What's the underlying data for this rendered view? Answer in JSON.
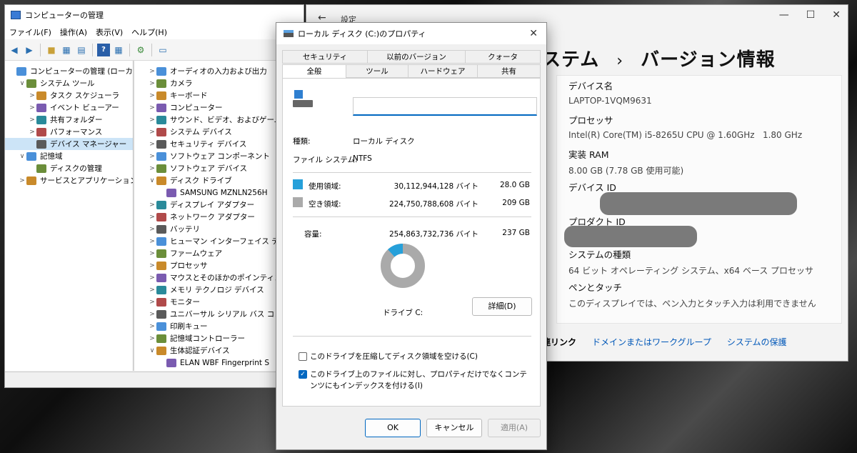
{
  "computer_management": {
    "title": "コンピューターの管理",
    "menu": [
      "ファイル(F)",
      "操作(A)",
      "表示(V)",
      "ヘルプ(H)"
    ],
    "tree": [
      {
        "label": "コンピューターの管理 (ローカル)",
        "arrow": "",
        "indent": 0
      },
      {
        "label": "システム ツール",
        "arrow": "∨",
        "indent": 1
      },
      {
        "label": "タスク スケジューラ",
        "arrow": ">",
        "indent": 2
      },
      {
        "label": "イベント ビューアー",
        "arrow": ">",
        "indent": 2
      },
      {
        "label": "共有フォルダー",
        "arrow": ">",
        "indent": 2
      },
      {
        "label": "パフォーマンス",
        "arrow": ">",
        "indent": 2
      },
      {
        "label": "デバイス マネージャー",
        "arrow": "",
        "indent": 2,
        "selected": true
      },
      {
        "label": "記憶域",
        "arrow": "∨",
        "indent": 1
      },
      {
        "label": "ディスクの管理",
        "arrow": "",
        "indent": 2
      },
      {
        "label": "サービスとアプリケーション",
        "arrow": ">",
        "indent": 1
      }
    ],
    "devices": [
      {
        "label": "オーディオの入力および出力",
        "arrow": ">",
        "indent": 1
      },
      {
        "label": "カメラ",
        "arrow": ">",
        "indent": 1
      },
      {
        "label": "キーボード",
        "arrow": ">",
        "indent": 1
      },
      {
        "label": "コンピューター",
        "arrow": ">",
        "indent": 1
      },
      {
        "label": "サウンド、ビデオ、およびゲーム コン",
        "arrow": ">",
        "indent": 1
      },
      {
        "label": "システム デバイス",
        "arrow": ">",
        "indent": 1
      },
      {
        "label": "セキュリティ デバイス",
        "arrow": ">",
        "indent": 1
      },
      {
        "label": "ソフトウェア コンポーネント",
        "arrow": ">",
        "indent": 1
      },
      {
        "label": "ソフトウェア デバイス",
        "arrow": ">",
        "indent": 1
      },
      {
        "label": "ディスク ドライブ",
        "arrow": "∨",
        "indent": 1
      },
      {
        "label": "SAMSUNG MZNLN256H",
        "arrow": "",
        "indent": 2
      },
      {
        "label": "ディスプレイ アダプター",
        "arrow": ">",
        "indent": 1
      },
      {
        "label": "ネットワーク アダプター",
        "arrow": ">",
        "indent": 1
      },
      {
        "label": "バッテリ",
        "arrow": ">",
        "indent": 1
      },
      {
        "label": "ヒューマン インターフェイス デバイス",
        "arrow": ">",
        "indent": 1
      },
      {
        "label": "ファームウェア",
        "arrow": ">",
        "indent": 1
      },
      {
        "label": "プロセッサ",
        "arrow": ">",
        "indent": 1
      },
      {
        "label": "マウスとそのほかのポインティング",
        "arrow": ">",
        "indent": 1
      },
      {
        "label": "メモリ テクノロジ デバイス",
        "arrow": ">",
        "indent": 1
      },
      {
        "label": "モニター",
        "arrow": ">",
        "indent": 1
      },
      {
        "label": "ユニバーサル シリアル バス コント",
        "arrow": ">",
        "indent": 1
      },
      {
        "label": "印刷キュー",
        "arrow": ">",
        "indent": 1
      },
      {
        "label": "記憶域コントローラー",
        "arrow": ">",
        "indent": 1
      },
      {
        "label": "生体認証デバイス",
        "arrow": "∨",
        "indent": 1
      },
      {
        "label": "ELAN WBF Fingerprint S",
        "arrow": "",
        "indent": 2
      }
    ]
  },
  "settings": {
    "title": "設定",
    "heading_prefix": "ステム",
    "heading_sep": "›",
    "heading": "バージョン情報",
    "device_name_label": "デバイス名",
    "device_name": "LAPTOP-1VQM9631",
    "processor_label": "プロセッサ",
    "processor": "Intel(R) Core(TM) i5-8265U CPU @ 1.60GHz   1.80 GHz",
    "ram_label": "実装 RAM",
    "ram": "8.00 GB (7.78 GB 使用可能)",
    "device_id_label": "デバイス ID",
    "product_id_label": "プロダクト ID",
    "system_type_label": "システムの種類",
    "system_type": "64 ビット オペレーティング システム、x64 ベース プロセッサ",
    "pen_label": "ペンとタッチ",
    "pen": "このディスプレイでは、ペン入力とタッチ入力は利用できません",
    "related_links": "連リンク",
    "link1": "ドメインまたはワークグループ",
    "link2": "システムの保護"
  },
  "properties": {
    "title": "ローカル ディスク (C:)のプロパティ",
    "tabs_row1": [
      "セキュリティ",
      "以前のバージョン",
      "クォータ"
    ],
    "tabs_row2": [
      "全般",
      "ツール",
      "ハードウェア",
      "共有"
    ],
    "type_label": "種類:",
    "type_value": "ローカル ディスク",
    "fs_label": "ファイル システム:",
    "fs_value": "NTFS",
    "used_label": "使用領域:",
    "used_bytes": "30,112,944,128 バイト",
    "used_gb": "28.0 GB",
    "free_label": "空き領域:",
    "free_bytes": "224,750,788,608 バイト",
    "free_gb": "209 GB",
    "cap_label": "容量:",
    "cap_bytes": "254,863,732,736 バイト",
    "cap_gb": "237 GB",
    "used_fraction": 0.118,
    "drive_label": "ドライブ C:",
    "detail_button": "詳細(D)",
    "compress_label": "このドライブを圧縮してディスク領域を空ける(C)",
    "index_label": "このドライブ上のファイルに対し、プロパティだけでなくコンテンツにもインデックスを付ける(I)",
    "ok": "OK",
    "cancel": "キャンセル",
    "apply": "適用(A)",
    "colors": {
      "used": "#26a0da",
      "free": "#aaaaaa"
    }
  }
}
